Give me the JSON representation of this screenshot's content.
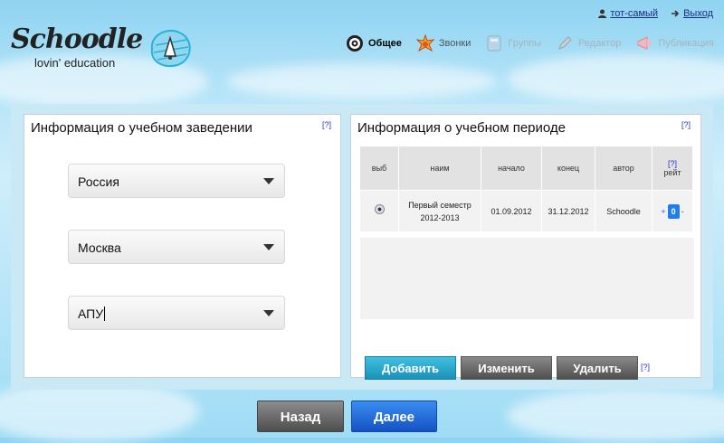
{
  "brand": {
    "name": "Schoodle",
    "tagline": "lovin' education"
  },
  "userbar": {
    "username": "тот-самый",
    "logout": "Выход"
  },
  "nav": {
    "items": [
      {
        "label": "Общее",
        "icon": "target-icon"
      },
      {
        "label": "Звонки",
        "icon": "bell-icon"
      },
      {
        "label": "Группы",
        "icon": "book-icon"
      },
      {
        "label": "Редактор",
        "icon": "pencil-icon"
      },
      {
        "label": "Публикация",
        "icon": "megaphone-icon"
      }
    ]
  },
  "institution": {
    "title": "Информация о учебном заведении",
    "help": "[?]",
    "country": "Россия",
    "city": "Москва",
    "school": "АПУ"
  },
  "period": {
    "title": "Информация о учебном периоде",
    "help": "[?]",
    "columns": {
      "select": "выб",
      "name": "наим",
      "start": "начало",
      "end": "конец",
      "author": "автор",
      "rating_help": "[?]",
      "rating": "рейт"
    },
    "rows": [
      {
        "name_line1": "Первый семестр",
        "name_line2": "2012-2013",
        "start": "01.09.2012",
        "end": "31.12.2012",
        "author": "Schoodle",
        "plus": "+",
        "rating": "0",
        "minus": "-"
      }
    ],
    "buttons": {
      "add": "Добавить",
      "edit": "Изменить",
      "delete": "Удалить",
      "help": "[?]"
    }
  },
  "footer": {
    "back": "Назад",
    "next": "Далее"
  },
  "colors": {
    "accent_teal": "#1a91b8",
    "next_blue": "#1f63d6",
    "link": "#1a2e80"
  }
}
